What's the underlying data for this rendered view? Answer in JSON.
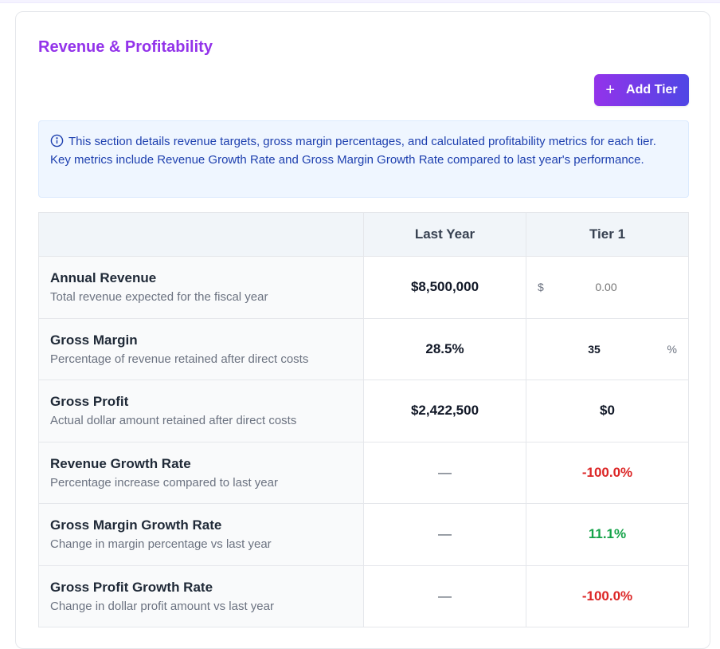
{
  "section": {
    "title": "Revenue & Profitability"
  },
  "actions": {
    "add_tier_label": "Add Tier",
    "add_icon": "plus-icon"
  },
  "info": {
    "icon": "info-circle-icon",
    "text": "This section details revenue targets, gross margin percentages, and calculated profitability metrics for each tier. Key metrics include Revenue Growth Rate and Gross Margin Growth Rate compared to last year's performance."
  },
  "table": {
    "headers": {
      "metric": "",
      "last_year": "Last Year",
      "tier1": "Tier 1"
    },
    "rows": [
      {
        "name": "Annual Revenue",
        "desc": "Total revenue expected for the fiscal year",
        "last_year": "$8,500,000",
        "tier1_prefix": "$",
        "tier1_placeholder": "0.00",
        "tier1_value": ""
      },
      {
        "name": "Gross Margin",
        "desc": "Percentage of revenue retained after direct costs",
        "last_year": "28.5%",
        "tier1_value": "35",
        "tier1_suffix": "%"
      },
      {
        "name": "Gross Profit",
        "desc": "Actual dollar amount retained after direct costs",
        "last_year": "$2,422,500",
        "tier1": "$0"
      },
      {
        "name": "Revenue Growth Rate",
        "desc": "Percentage increase compared to last year",
        "last_year": "—",
        "tier1": "-100.0%"
      },
      {
        "name": "Gross Margin Growth Rate",
        "desc": "Change in margin percentage vs last year",
        "last_year": "—",
        "tier1": "11.1%"
      },
      {
        "name": "Gross Profit Growth Rate",
        "desc": "Change in dollar profit amount vs last year",
        "last_year": "—",
        "tier1": "-100.0%"
      }
    ]
  },
  "colors": {
    "title": "#9333ea",
    "button_gradient_start": "#9333ea",
    "button_gradient_end": "#4f46e5",
    "info_bg": "#eff6ff",
    "info_text": "#1e40af",
    "negative": "#dc2626",
    "positive": "#16a34a"
  }
}
